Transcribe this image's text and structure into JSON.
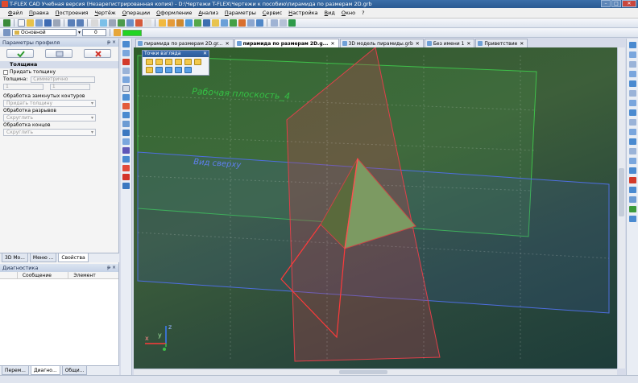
{
  "window": {
    "title": "T-FLEX CAD Учебная версия (Незарегистрированная копия) - D:\\Чертежи T-FLEX\\Чертежи к пособию\\пирамида по размерам 2D.grb"
  },
  "menu": [
    "Файл",
    "Правка",
    "Построения",
    "Чертёж",
    "Операции",
    "Оформление",
    "Анализ",
    "Параметры",
    "Сервис",
    "Настройка",
    "Вид",
    "Окно",
    "?"
  ],
  "toolbar": {
    "layer_value": "Основной",
    "number_value": "0",
    "accent_color": "#22d422"
  },
  "profile_panel": {
    "title": "Параметры профиля",
    "pin": "ᵽ ×",
    "section": "Толщина",
    "add_thickness": "Придать толщину",
    "thickness_label": "Толщина:",
    "thickness_mode": "Симметрично",
    "spin1": "1",
    "spin2": "1",
    "closed_contours_label": "Обработка замкнутых контуров",
    "closed_contours_value": "Придать толщину",
    "breaks_label": "Обработка разрывов",
    "breaks_value": "Скруглить",
    "ends_label": "Обработка концов",
    "ends_value": "Скруглить"
  },
  "panel_tabs": [
    "3D Мо...",
    "Меню ...",
    "Свойства"
  ],
  "diagnostics": {
    "title": "Диагностика",
    "pin": "ᵽ ×",
    "columns": [
      "Сообщение",
      "Элемент"
    ]
  },
  "bottom_tabs": [
    "Перем...",
    "Диагно...",
    "Общи..."
  ],
  "doc_tabs": [
    {
      "label": "пирамида по размерам 2D.gr...",
      "active": false
    },
    {
      "label": "пирамида по размерам 2D.g...",
      "active": true
    },
    {
      "label": "3D модель пирамиды.grb",
      "active": false
    },
    {
      "label": "Без имени 1",
      "active": false
    },
    {
      "label": "Приветствие",
      "active": false
    }
  ],
  "viewport": {
    "viewpoints_title": "Точки взгляда",
    "plane_label_1": "Рабочая плоскость_4",
    "plane_label_2": "Вид сверху",
    "axis_labels": {
      "x": "x",
      "y": "y",
      "z": "z"
    }
  }
}
